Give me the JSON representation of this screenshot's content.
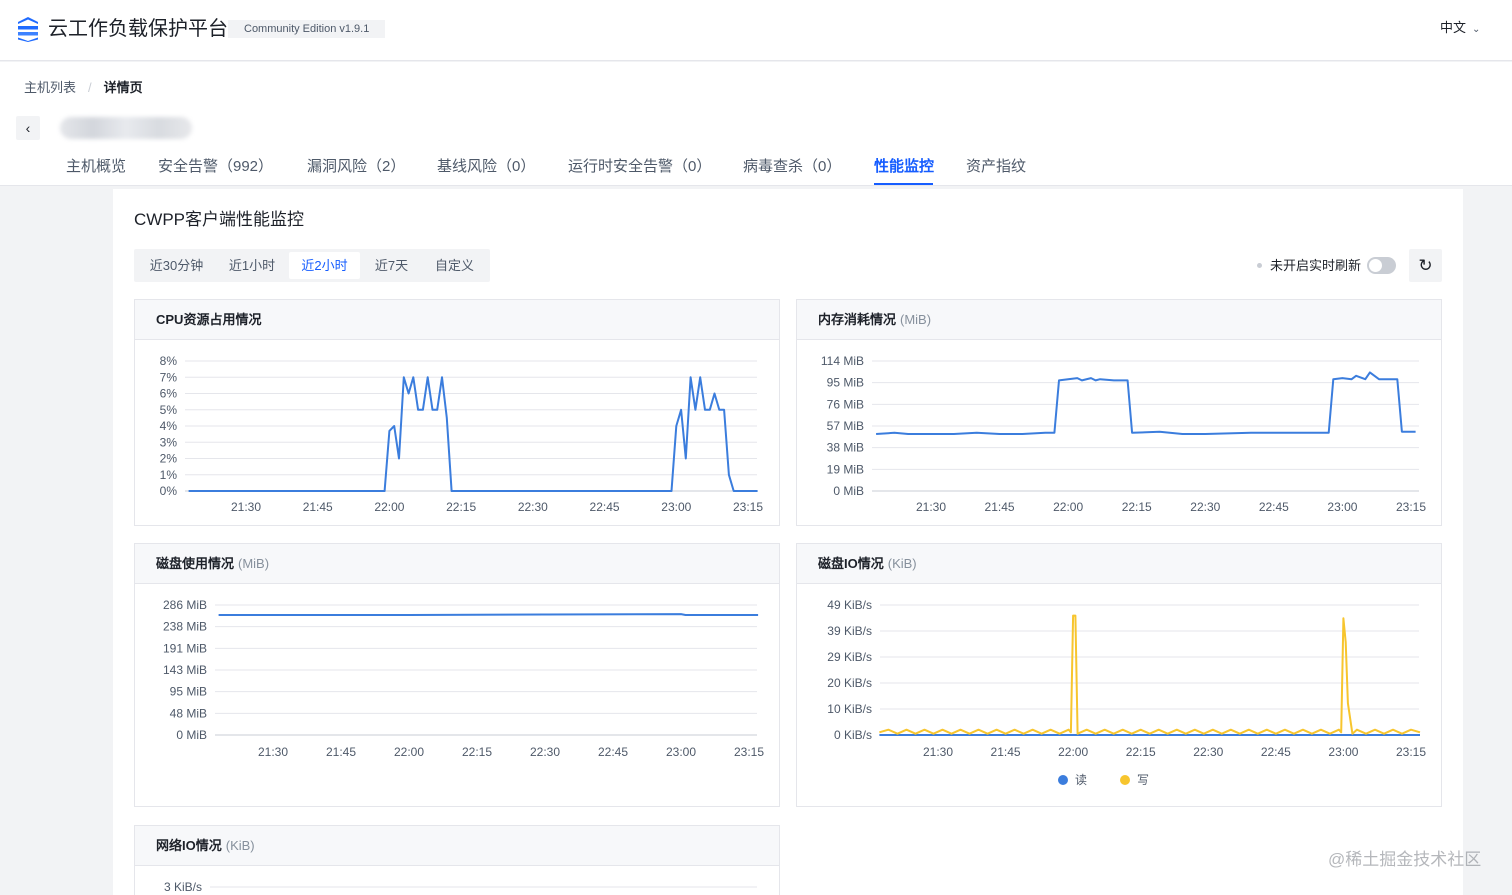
{
  "header": {
    "title": "云工作负载保护平台",
    "edition": "Community Edition v1.9.1",
    "language": "中文",
    "brand_color": "#165dff"
  },
  "breadcrumb": {
    "items": [
      "主机列表",
      "详情页"
    ],
    "separator": "/"
  },
  "host": {
    "back_icon": "chevron-left-icon"
  },
  "tabs": [
    {
      "label": "主机概览",
      "active": false
    },
    {
      "label": "安全告警（992）",
      "active": false
    },
    {
      "label": "漏洞风险（2）",
      "active": false
    },
    {
      "label": "基线风险（0）",
      "active": false
    },
    {
      "label": "运行时安全告警（0）",
      "active": false
    },
    {
      "label": "病毒查杀（0）",
      "active": false
    },
    {
      "label": "性能监控",
      "active": true
    },
    {
      "label": "资产指纹",
      "active": false
    }
  ],
  "section": {
    "title": "CWPP客户端性能监控"
  },
  "time_range": {
    "options": [
      "近30分钟",
      "近1小时",
      "近2小时",
      "近7天",
      "自定义"
    ],
    "selected": "近2小时"
  },
  "realtime": {
    "label": "未开启实时刷新",
    "enabled": false,
    "refresh_icon": "refresh-icon"
  },
  "charts": {
    "cpu": {
      "title": "CPU资源占用情况",
      "unit": ""
    },
    "memory": {
      "title": "内存消耗情况",
      "unit": "(MiB)"
    },
    "disk": {
      "title": "磁盘使用情况",
      "unit": "(MiB)"
    },
    "diskio": {
      "title": "磁盘IO情况",
      "unit": "(KiB)",
      "legend": [
        "读",
        "写"
      ]
    },
    "netio": {
      "title": "网络IO情况",
      "unit": "(KiB)"
    }
  },
  "chart_data": [
    {
      "id": "cpu",
      "type": "line",
      "title": "CPU资源占用情况",
      "y_ticks": [
        "0%",
        "1%",
        "2%",
        "3%",
        "4%",
        "5%",
        "6%",
        "7%",
        "8%"
      ],
      "ylim": [
        0,
        8
      ],
      "x_ticks": [
        "21:30",
        "21:45",
        "22:00",
        "22:15",
        "22:30",
        "22:45",
        "23:00",
        "23:15"
      ],
      "grid": true,
      "color": "#3b7ddd",
      "series": [
        {
          "x": [
            "21:18",
            "21:59",
            "22:00",
            "22:01",
            "22:02",
            "22:03",
            "22:04",
            "22:05",
            "22:06",
            "22:07",
            "22:08",
            "22:09",
            "22:10",
            "22:11",
            "22:12",
            "22:13",
            "22:59",
            "23:00",
            "23:01",
            "23:02",
            "23:03",
            "23:04",
            "23:05",
            "23:06",
            "23:07",
            "23:08",
            "23:09",
            "23:10",
            "23:11",
            "23:12",
            "23:17"
          ],
          "values": [
            0,
            0,
            3.7,
            4,
            2,
            7,
            6,
            7,
            5,
            5,
            7,
            5,
            5,
            7,
            4.5,
            0,
            0,
            4,
            5,
            2,
            7,
            5,
            7,
            5,
            5,
            6,
            5,
            5,
            1,
            0,
            0
          ]
        }
      ]
    },
    {
      "id": "memory",
      "type": "line",
      "title": "内存消耗情况",
      "y_ticks": [
        "0 MiB",
        "19 MiB",
        "38 MiB",
        "57 MiB",
        "76 MiB",
        "95 MiB",
        "114 MiB"
      ],
      "ylim": [
        0,
        114
      ],
      "x_ticks": [
        "21:30",
        "21:45",
        "22:00",
        "22:15",
        "22:30",
        "22:45",
        "23:00",
        "23:15"
      ],
      "grid": true,
      "color": "#3b7ddd",
      "series": [
        {
          "x": [
            "21:18",
            "21:22",
            "21:25",
            "21:35",
            "21:40",
            "21:45",
            "21:50",
            "21:55",
            "21:57",
            "21:58",
            "22:00",
            "22:02",
            "22:03",
            "22:05",
            "22:06",
            "22:07",
            "22:10",
            "22:13",
            "22:14",
            "22:20",
            "22:25",
            "22:30",
            "22:40",
            "22:45",
            "22:50",
            "22:56",
            "22:57",
            "22:58",
            "23:00",
            "23:02",
            "23:03",
            "23:05",
            "23:06",
            "23:08",
            "23:12",
            "23:13",
            "23:16"
          ],
          "values": [
            50,
            51,
            50,
            50,
            51,
            50,
            50,
            51,
            51,
            97,
            98,
            99,
            97,
            99,
            97,
            98,
            97,
            97,
            51,
            52,
            50,
            50,
            51,
            51,
            51,
            51,
            51,
            98,
            99,
            98,
            101,
            98,
            104,
            98,
            98,
            52,
            52
          ]
        }
      ]
    },
    {
      "id": "disk",
      "type": "line",
      "title": "磁盘使用情况",
      "y_ticks": [
        "0 MiB",
        "48 MiB",
        "95 MiB",
        "143 MiB",
        "191 MiB",
        "238 MiB",
        "286 MiB"
      ],
      "ylim": [
        0,
        286
      ],
      "x_ticks": [
        "21:30",
        "21:45",
        "22:00",
        "22:15",
        "22:30",
        "22:45",
        "23:00",
        "23:15"
      ],
      "grid": true,
      "color": "#3b7ddd",
      "series": [
        {
          "x": [
            "21:18",
            "22:00",
            "22:30",
            "23:00",
            "23:01",
            "23:17"
          ],
          "values": [
            264,
            264,
            265,
            266,
            264,
            264
          ]
        }
      ]
    },
    {
      "id": "diskio",
      "type": "line",
      "title": "磁盘IO情况",
      "y_ticks": [
        "0 KiB/s",
        "10 KiB/s",
        "20 KiB/s",
        "29 KiB/s",
        "39 KiB/s",
        "49 KiB/s"
      ],
      "ylim": [
        0,
        49
      ],
      "x_ticks": [
        "21:30",
        "21:45",
        "22:00",
        "22:15",
        "22:30",
        "22:45",
        "23:00",
        "23:15"
      ],
      "grid": true,
      "legend": "bottom-center",
      "series": [
        {
          "name": "读",
          "color": "#3b7ddd",
          "x": [
            "21:17",
            "23:17"
          ],
          "values": [
            0,
            0
          ]
        },
        {
          "name": "写",
          "color": "#f7c52e",
          "x": [
            "21:17",
            "21:19",
            "21:21",
            "21:23",
            "21:25",
            "21:27",
            "21:29",
            "21:31",
            "21:33",
            "21:35",
            "21:37",
            "21:39",
            "21:41",
            "21:43",
            "21:45",
            "21:47",
            "21:49",
            "21:51",
            "21:53",
            "21:55",
            "21:57",
            "21:59",
            "21:59.5",
            "22:00",
            "22:00.5",
            "22:01",
            "22:03",
            "22:05",
            "22:07",
            "22:09",
            "22:11",
            "22:13",
            "22:15",
            "22:17",
            "22:19",
            "22:21",
            "22:23",
            "22:25",
            "22:27",
            "22:29",
            "22:31",
            "22:33",
            "22:35",
            "22:37",
            "22:39",
            "22:41",
            "22:43",
            "22:45",
            "22:47",
            "22:49",
            "22:51",
            "22:53",
            "22:55",
            "22:57",
            "22:59",
            "22:59.5",
            "23:00",
            "23:00.5",
            "23:01",
            "23:02",
            "23:03",
            "23:05",
            "23:07",
            "23:09",
            "23:11",
            "23:13",
            "23:15",
            "23:17"
          ],
          "values": [
            1,
            2,
            0.5,
            2,
            0.5,
            2,
            0.5,
            2,
            0.5,
            2,
            0.5,
            2,
            0.5,
            2,
            0.5,
            2,
            0.5,
            2,
            0.5,
            2,
            0.5,
            2,
            1,
            45,
            45,
            0.5,
            2,
            0.5,
            2,
            0.5,
            2,
            0.5,
            2,
            0.5,
            2,
            0.5,
            2,
            0.5,
            2,
            0.5,
            2,
            0.5,
            2,
            0.5,
            2,
            0.5,
            2,
            0.5,
            2,
            0.5,
            2,
            0.5,
            2,
            0.5,
            2,
            1,
            44,
            35,
            12,
            0.5,
            2,
            0.5,
            2,
            0.5,
            2,
            0.5,
            2,
            1
          ]
        }
      ]
    },
    {
      "id": "netio",
      "type": "line",
      "title": "网络IO情况",
      "y_ticks": [
        "3 KiB/s"
      ],
      "grid": true,
      "series": []
    }
  ],
  "watermark": "@稀土掘金技术社区"
}
